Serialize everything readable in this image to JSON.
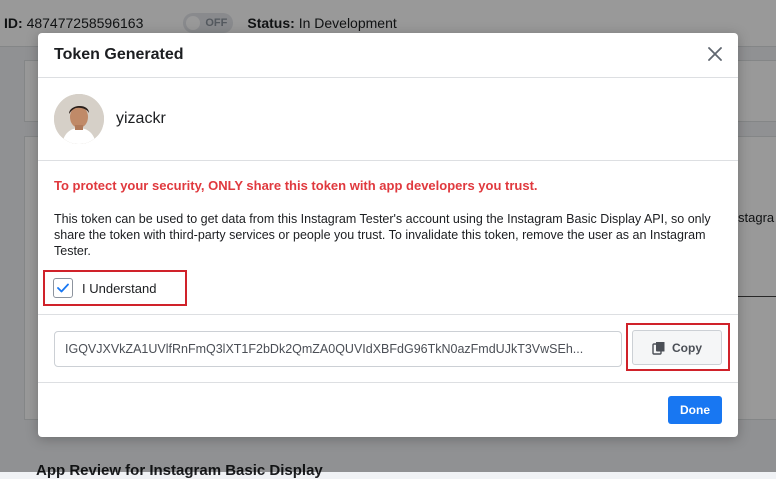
{
  "background": {
    "id_label": "ID:",
    "id_value": "487477258596163",
    "toggle_label": "OFF",
    "status_label": "Status:",
    "status_value": "In Development",
    "side_text": "stagra",
    "bottom_title": "App Review for Instagram Basic Display"
  },
  "modal": {
    "title": "Token Generated",
    "user": {
      "name": "yizackr"
    },
    "warning": "To protect your security, ONLY share this token with app developers you trust.",
    "info": "This token can be used to get data from this Instagram Tester's account using the Instagram Basic Display API, so only share the token with third-party services or people you trust. To invalidate this token, remove the user as an Instagram Tester.",
    "understand": {
      "label": "I Understand",
      "checked": true
    },
    "token_value": "IGQVJXVkZA1UVlfRnFmQ3lXT1F2bDk2QmZA0QUVIdXBFdG96TkN0azFmdUJkT3VwSEh...",
    "copy_label": "Copy",
    "done_label": "Done"
  },
  "colors": {
    "warning": "#e0393e",
    "primary": "#1877f2",
    "highlight": "#d0222a",
    "check": "#1877f2"
  }
}
